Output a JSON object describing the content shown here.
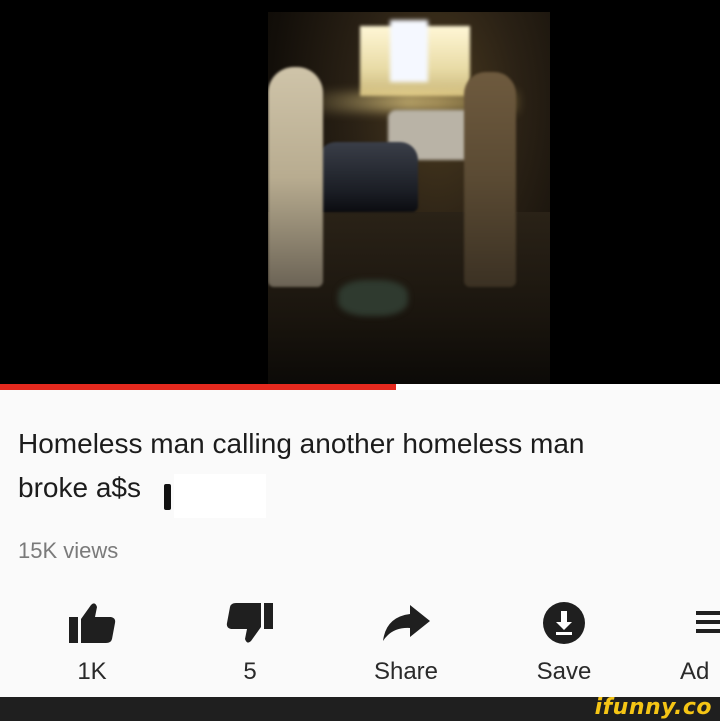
{
  "video": {
    "progress_fraction": 0.55,
    "progress_color": "#e5291e"
  },
  "title": {
    "line1": "Homeless man calling another homeless man",
    "line2": "broke a$s"
  },
  "views": "15K views",
  "actions": [
    {
      "icon": "thumbs-up-icon",
      "label": "1K"
    },
    {
      "icon": "thumbs-down-icon",
      "label": "5"
    },
    {
      "icon": "share-icon",
      "label": "Share"
    },
    {
      "icon": "save-icon",
      "label": "Save"
    },
    {
      "icon": "add-to-playlist-icon",
      "label": "Ad"
    }
  ],
  "watermark": "ifunny.co"
}
